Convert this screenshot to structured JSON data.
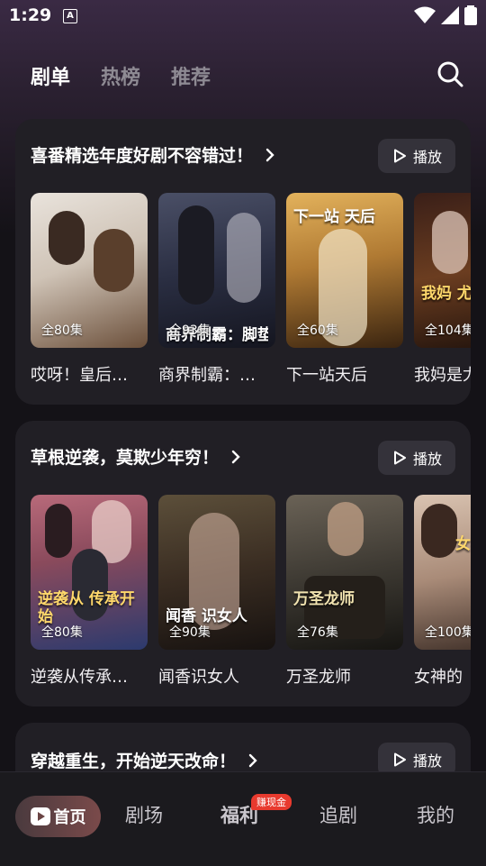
{
  "status": {
    "time": "1:29",
    "app_icon": "A"
  },
  "top_tabs": [
    {
      "label": "剧单",
      "active": true
    },
    {
      "label": "热榜",
      "active": false
    },
    {
      "label": "推荐",
      "active": false
    }
  ],
  "icons": {
    "search": "search-icon",
    "play": "play-icon",
    "chevron": "chevron-right-icon"
  },
  "sections": [
    {
      "title": "喜番精选年度好剧不容错过！",
      "play_label": "播放",
      "items": [
        {
          "name": "哎呀！皇后…",
          "episodes": "全80集",
          "poster_text": ""
        },
        {
          "name": "商界制霸：…",
          "episodes": "全93集",
          "poster_text": "商界制霸：脚垫崛起"
        },
        {
          "name": "下一站天后",
          "episodes": "全60集",
          "poster_text": "下一站 天后"
        },
        {
          "name": "我妈是尤",
          "episodes": "全104集",
          "poster_text": "我妈 尤"
        }
      ]
    },
    {
      "title": "草根逆袭，莫欺少年穷！",
      "play_label": "播放",
      "items": [
        {
          "name": "逆袭从传承…",
          "episodes": "全80集",
          "poster_text": "逆袭从 传承开始"
        },
        {
          "name": "闻香识女人",
          "episodes": "全90集",
          "poster_text": "闻香 识女人"
        },
        {
          "name": "万圣龙师",
          "episodes": "全76集",
          "poster_text": "万圣龙师"
        },
        {
          "name": "女神的",
          "episodes": "全100集",
          "poster_text": "女神 近"
        }
      ]
    },
    {
      "title": "穿越重生，开始逆天改命！",
      "play_label": "播放",
      "items": []
    }
  ],
  "bottom_nav": [
    {
      "label": "首页",
      "active": true
    },
    {
      "label": "剧场",
      "active": false
    },
    {
      "label": "福利",
      "active": false,
      "badge": "赚现金"
    },
    {
      "label": "追剧",
      "active": false
    },
    {
      "label": "我的",
      "active": false
    }
  ]
}
